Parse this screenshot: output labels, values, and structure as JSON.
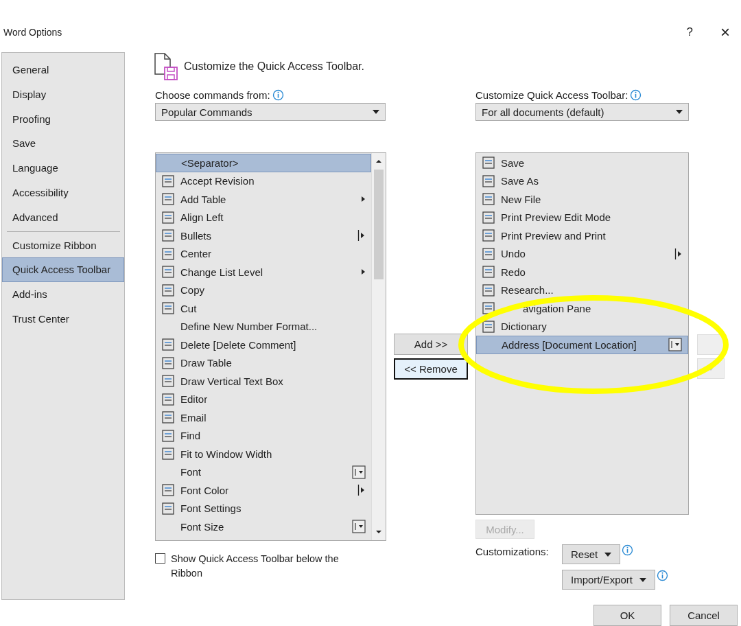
{
  "window": {
    "title": "Word Options",
    "help": "?",
    "close": "×"
  },
  "sidebar": {
    "items": [
      {
        "label": "General",
        "selected": false,
        "divider_after": false
      },
      {
        "label": "Display",
        "selected": false,
        "divider_after": false
      },
      {
        "label": "Proofing",
        "selected": false,
        "divider_after": false
      },
      {
        "label": "Save",
        "selected": false,
        "divider_after": false
      },
      {
        "label": "Language",
        "selected": false,
        "divider_after": false
      },
      {
        "label": "Accessibility",
        "selected": false,
        "divider_after": false
      },
      {
        "label": "Advanced",
        "selected": false,
        "divider_after": true
      },
      {
        "label": "Customize Ribbon",
        "selected": false,
        "divider_after": false
      },
      {
        "label": "Quick Access Toolbar",
        "selected": true,
        "divider_after": false
      },
      {
        "label": "Add-ins",
        "selected": false,
        "divider_after": false
      },
      {
        "label": "Trust Center",
        "selected": false,
        "divider_after": false
      }
    ]
  },
  "heading": "Customize the Quick Access Toolbar.",
  "choose_from": {
    "label": "Choose commands from:",
    "value": "Popular Commands"
  },
  "customize_for": {
    "label": "Customize Quick Access Toolbar:",
    "value": "For all documents (default)"
  },
  "commands": [
    {
      "label": "<Separator>",
      "has_icon": false,
      "kind": "plain",
      "selected": true
    },
    {
      "label": "Accept Revision",
      "has_icon": true,
      "kind": "plain",
      "selected": false
    },
    {
      "label": "Add Table",
      "has_icon": true,
      "kind": "submenu",
      "selected": false
    },
    {
      "label": "Align Left",
      "has_icon": true,
      "kind": "plain",
      "selected": false
    },
    {
      "label": "Bullets",
      "has_icon": true,
      "kind": "split",
      "selected": false
    },
    {
      "label": "Center",
      "has_icon": true,
      "kind": "plain",
      "selected": false
    },
    {
      "label": "Change List Level",
      "has_icon": true,
      "kind": "submenu",
      "selected": false
    },
    {
      "label": "Copy",
      "has_icon": true,
      "kind": "plain",
      "selected": false
    },
    {
      "label": "Cut",
      "has_icon": true,
      "kind": "plain",
      "selected": false
    },
    {
      "label": "Define New Number Format...",
      "has_icon": false,
      "kind": "plain",
      "selected": false
    },
    {
      "label": "Delete [Delete Comment]",
      "has_icon": true,
      "kind": "plain",
      "selected": false
    },
    {
      "label": "Draw Table",
      "has_icon": true,
      "kind": "plain",
      "selected": false
    },
    {
      "label": "Draw Vertical Text Box",
      "has_icon": true,
      "kind": "plain",
      "selected": false
    },
    {
      "label": "Editor",
      "has_icon": true,
      "kind": "plain",
      "selected": false
    },
    {
      "label": "Email",
      "has_icon": true,
      "kind": "plain",
      "selected": false
    },
    {
      "label": "Find",
      "has_icon": true,
      "kind": "plain",
      "selected": false
    },
    {
      "label": "Fit to Window Width",
      "has_icon": true,
      "kind": "plain",
      "selected": false
    },
    {
      "label": "Font",
      "has_icon": false,
      "kind": "combo",
      "selected": false
    },
    {
      "label": "Font Color",
      "has_icon": true,
      "kind": "split",
      "selected": false
    },
    {
      "label": "Font Settings",
      "has_icon": true,
      "kind": "plain",
      "selected": false
    },
    {
      "label": "Font Size",
      "has_icon": false,
      "kind": "combo",
      "selected": false
    }
  ],
  "toolbar_commands": [
    {
      "label": "Save",
      "has_icon": true,
      "kind": "plain",
      "selected": false
    },
    {
      "label": "Save As",
      "has_icon": true,
      "kind": "plain",
      "selected": false
    },
    {
      "label": "New File",
      "has_icon": true,
      "kind": "plain",
      "selected": false
    },
    {
      "label": "Print Preview Edit Mode",
      "has_icon": true,
      "kind": "plain",
      "selected": false
    },
    {
      "label": "Print Preview and Print",
      "has_icon": true,
      "kind": "plain",
      "selected": false
    },
    {
      "label": "Undo",
      "has_icon": true,
      "kind": "split",
      "selected": false
    },
    {
      "label": "Redo",
      "has_icon": true,
      "kind": "plain",
      "selected": false
    },
    {
      "label": "Research...",
      "has_icon": true,
      "kind": "plain",
      "selected": false
    },
    {
      "label": "avigation Pane",
      "has_icon": true,
      "kind": "plain",
      "selected": false
    },
    {
      "label": "Dictionary",
      "has_icon": true,
      "kind": "plain",
      "selected": false
    },
    {
      "label": "Address [Document Location]",
      "has_icon": false,
      "kind": "combo",
      "selected": true
    }
  ],
  "add_button": "Add >>",
  "remove_button": "<< Remove",
  "show_below": {
    "label": "Show Quick Access Toolbar below the Ribbon",
    "checked": false
  },
  "modify_button": {
    "label": "Modify...",
    "disabled": true
  },
  "customizations_label": "Customizations:",
  "reset_button": "Reset",
  "import_export_button": "Import/Export",
  "ok_button": "OK",
  "cancel_button": "Cancel",
  "annotations": [
    {
      "kind": "ellipse"
    }
  ]
}
